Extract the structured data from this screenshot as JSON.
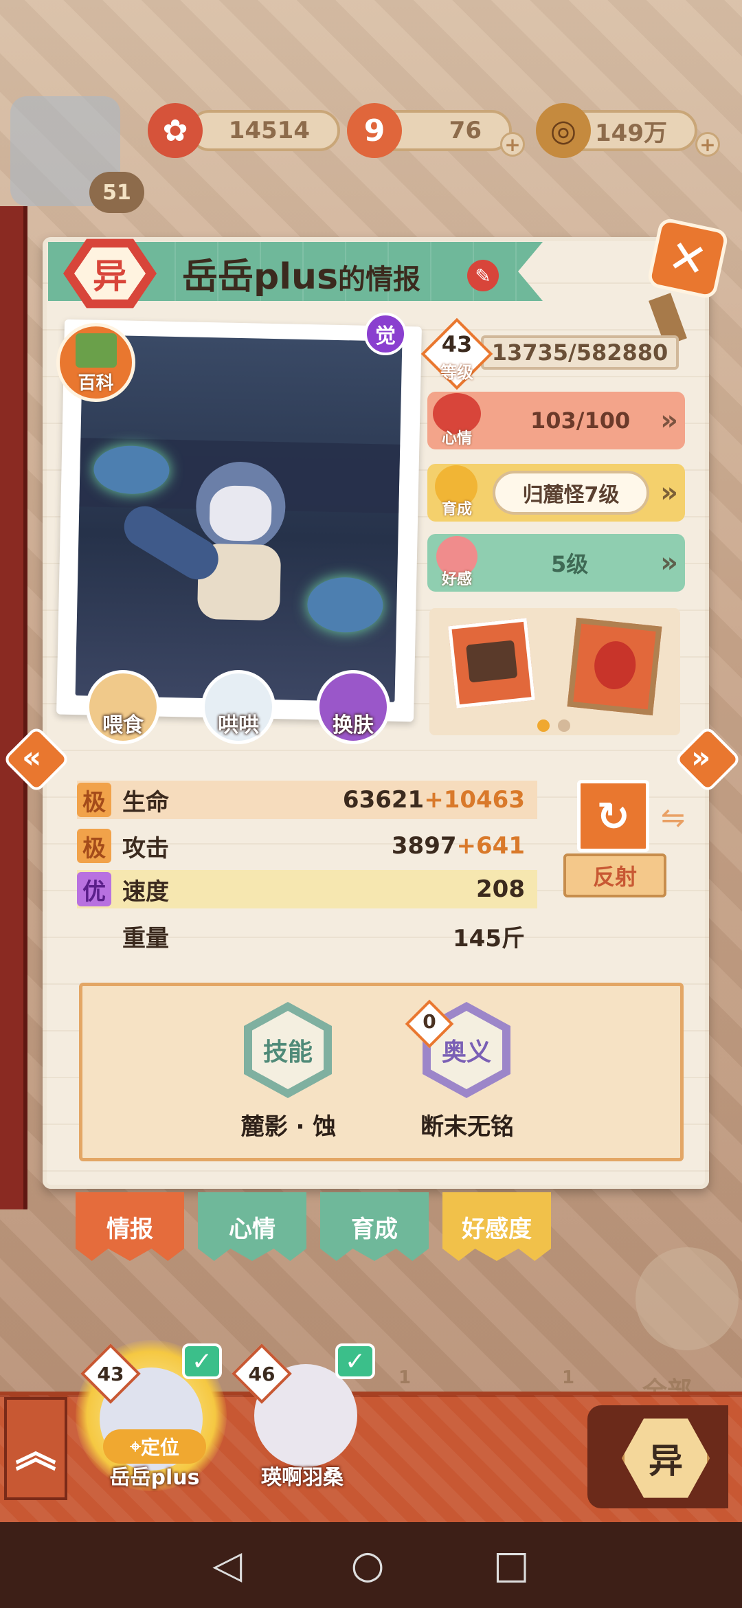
{
  "resources": [
    {
      "icon": "flower-currency-icon",
      "value": "14514"
    },
    {
      "icon": "nine-tail-icon",
      "value": "76"
    },
    {
      "icon": "coin-icon",
      "value": "149万"
    }
  ],
  "player_level": "51",
  "header": {
    "badge": "异",
    "name": "岳岳plus",
    "suffix": "的情报"
  },
  "portrait": {
    "awaken_badge": "觉",
    "wiki_label": "百科"
  },
  "actions": {
    "feed": "喂食",
    "coax": "哄哄",
    "skin": "换肤"
  },
  "level": {
    "value": "43",
    "label": "等级",
    "exp": "13735/582880"
  },
  "mood": {
    "label": "心情",
    "value": "103/100"
  },
  "growth": {
    "label": "育成",
    "value": "归麓怪7级"
  },
  "affinity": {
    "label": "好感",
    "value": "5级"
  },
  "stats": [
    {
      "grade": "极",
      "name": "生命",
      "base": "63621",
      "bonus": "+10463"
    },
    {
      "grade": "极",
      "name": "攻击",
      "base": "3897",
      "bonus": "+641"
    },
    {
      "grade": "优",
      "name": "速度",
      "base": "208",
      "bonus": ""
    },
    {
      "grade": "",
      "name": "重量",
      "base": "145斤",
      "bonus": ""
    }
  ],
  "trait": {
    "label": "反射"
  },
  "skills": {
    "skill": {
      "icon": "技能",
      "name": "麓影 · 蚀"
    },
    "ultimate": {
      "icon": "奥义",
      "count": "0",
      "name": "断末无铭"
    }
  },
  "tabs": [
    "情报",
    "心情",
    "育成",
    "好感度"
  ],
  "roster": [
    {
      "level": "43",
      "name": "岳岳plus",
      "locate": "定位"
    },
    {
      "level": "46",
      "name": "瑛啊羽桑"
    }
  ],
  "filter_button": "异",
  "bg_counts": [
    "1",
    "1"
  ],
  "bg_all": "全部"
}
